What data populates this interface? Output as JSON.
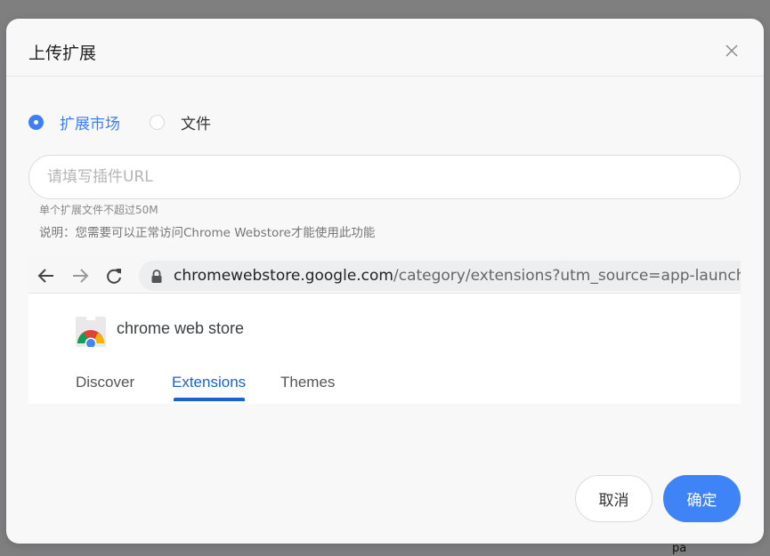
{
  "dialog": {
    "title": "上传扩展",
    "close_icon": "close-icon"
  },
  "source_options": [
    {
      "label": "扩展市场",
      "selected": true
    },
    {
      "label": "文件",
      "selected": false
    }
  ],
  "url_input": {
    "value": "",
    "placeholder": "请填写插件URL"
  },
  "hints": {
    "size_limit": "单个扩展文件不超过50M",
    "note": "说明：您需要可以正常访问Chrome Webstore才能使用此功能"
  },
  "preview": {
    "address_domain": "chromewebstore.google.com",
    "address_path": "/category/extensions?utm_source=app-launcher",
    "store_name": "chrome web store",
    "tabs": [
      {
        "label": "Discover",
        "active": false
      },
      {
        "label": "Extensions",
        "active": true
      },
      {
        "label": "Themes",
        "active": false
      }
    ],
    "icons": [
      "back-arrow-icon",
      "forward-arrow-icon",
      "reload-icon",
      "lock-icon",
      "chrome-web-store-logo"
    ]
  },
  "footer": {
    "cancel_label": "取消",
    "confirm_label": "确定"
  },
  "background_text": "pa",
  "colors": {
    "accent": "#3f84f6",
    "active_tab": "#1a63d1",
    "overlay": "#7f7f80"
  }
}
